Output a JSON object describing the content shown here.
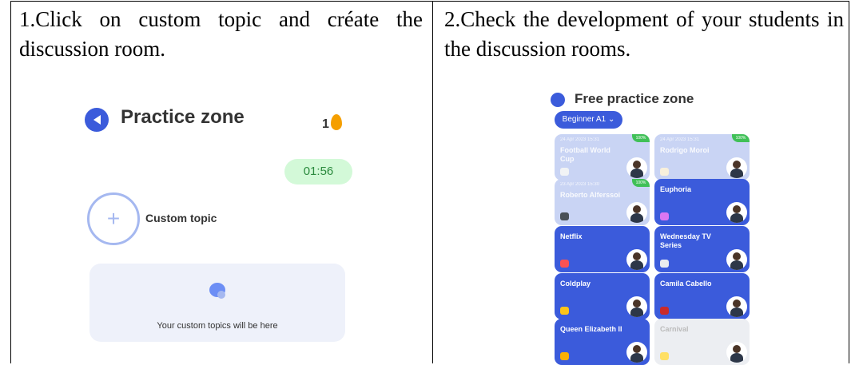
{
  "document": {
    "cells": [
      {
        "text": "1.Click on custom topic and créate the discussion room."
      },
      {
        "text": "2.Check the development of your students in the discussion rooms."
      }
    ]
  },
  "left_screen": {
    "title": "Practice zone",
    "streak_count": "1",
    "timer": "01:56",
    "custom_topic_label": "Custom topic",
    "custom_topics_empty_text": "Your custom topics will be here",
    "icons": {
      "header": "practice-zone-icon",
      "streak": "flame-icon",
      "add": "plus-icon",
      "chat": "chat-icon"
    },
    "colors": {
      "accent": "#3b5bdb",
      "timer_bg": "#d3f9d8",
      "panel_bg": "#eef1fa"
    }
  },
  "right_screen": {
    "title": "Free practice zone",
    "level_selector": "Beginner A1 ⌄",
    "rooms": [
      {
        "title": "Football World Cup",
        "meta": "24 Apr 2023 15:31",
        "badge": "100%",
        "state": "completed",
        "icon": "eye-icon",
        "avatar": "student-avatar"
      },
      {
        "title": "Rodrigo Moroi",
        "meta": "24 Apr 2023 15:31",
        "badge": "100%",
        "state": "completed",
        "icon": "face-icon",
        "avatar": "student-avatar"
      },
      {
        "title": "Roberto Alferssoi",
        "meta": "23 Apr 2023 15:30",
        "badge": "100%",
        "state": "completed",
        "icon": "hat-icon",
        "avatar": "student-avatar"
      },
      {
        "title": "Euphoria",
        "meta": "",
        "badge": "",
        "state": "active",
        "icon": "heart-icon",
        "avatar": "student-avatar"
      },
      {
        "title": "Netflix",
        "meta": "",
        "badge": "",
        "state": "active",
        "icon": "popcorn-icon",
        "avatar": "student-avatar"
      },
      {
        "title": "Wednesday TV Series",
        "meta": "",
        "badge": "",
        "state": "active",
        "icon": "skull-icon",
        "avatar": "student-avatar"
      },
      {
        "title": "Coldplay",
        "meta": "",
        "badge": "",
        "state": "active",
        "icon": "rock-hand-icon",
        "avatar": "student-avatar"
      },
      {
        "title": "Camila Cabello",
        "meta": "",
        "badge": "",
        "state": "active",
        "icon": "lips-icon",
        "avatar": "student-avatar"
      },
      {
        "title": "Queen Elizabeth II",
        "meta": "",
        "badge": "",
        "state": "active",
        "icon": "crown-icon",
        "avatar": "student-avatar"
      },
      {
        "title": "Carnival",
        "meta": "",
        "badge": "",
        "state": "inactive",
        "icon": "party-icon",
        "avatar": "student-avatar"
      }
    ],
    "colors": {
      "active_card": "#3b5bdb",
      "completed_card": "#c9d4f4",
      "inactive_card": "#eceef2",
      "badge": "#40c057"
    }
  }
}
